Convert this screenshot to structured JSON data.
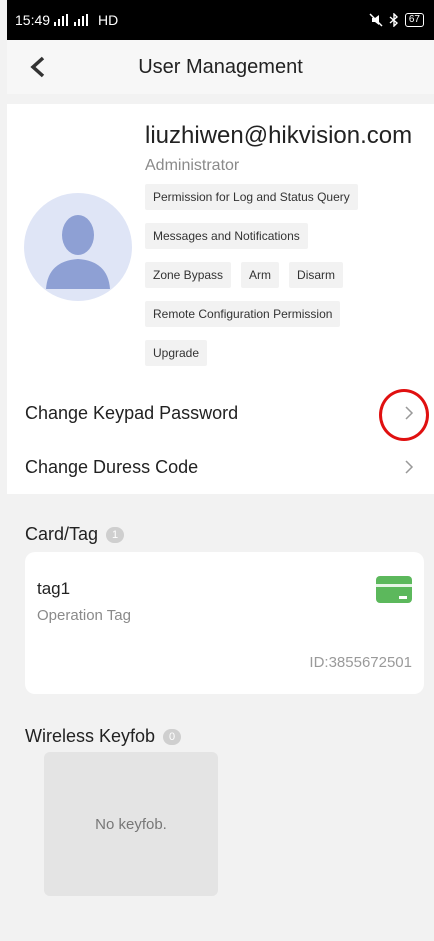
{
  "status_bar": {
    "time": "15:49",
    "signal_text": "HD",
    "battery": "67"
  },
  "nav": {
    "title": "User Management"
  },
  "profile": {
    "email": "liuzhiwen@hikvision.com",
    "role": "Administrator",
    "permissions": [
      [
        "Permission for Log and Status Query"
      ],
      [
        "Messages and Notifications"
      ],
      [
        "Zone Bypass",
        "Arm",
        "Disarm"
      ],
      [
        "Remote Configuration Permission"
      ],
      [
        "Upgrade"
      ]
    ]
  },
  "settings": {
    "change_keypad_password": "Change Keypad Password",
    "change_duress_code": "Change Duress Code"
  },
  "card_tag": {
    "title": "Card/Tag",
    "count": "1",
    "items": [
      {
        "name": "tag1",
        "type": "Operation Tag",
        "id": "ID:3855672501"
      }
    ]
  },
  "wireless_keyfob": {
    "title": "Wireless Keyfob",
    "count": "0",
    "empty_text": "No keyfob."
  },
  "colors": {
    "accent_green": "#5cb85c",
    "highlight_red": "#e01010"
  },
  "icons": [
    "back-icon",
    "chevron-right-icon",
    "card-icon",
    "avatar-icon",
    "signal-icon",
    "bluetooth-icon",
    "battery-icon"
  ]
}
